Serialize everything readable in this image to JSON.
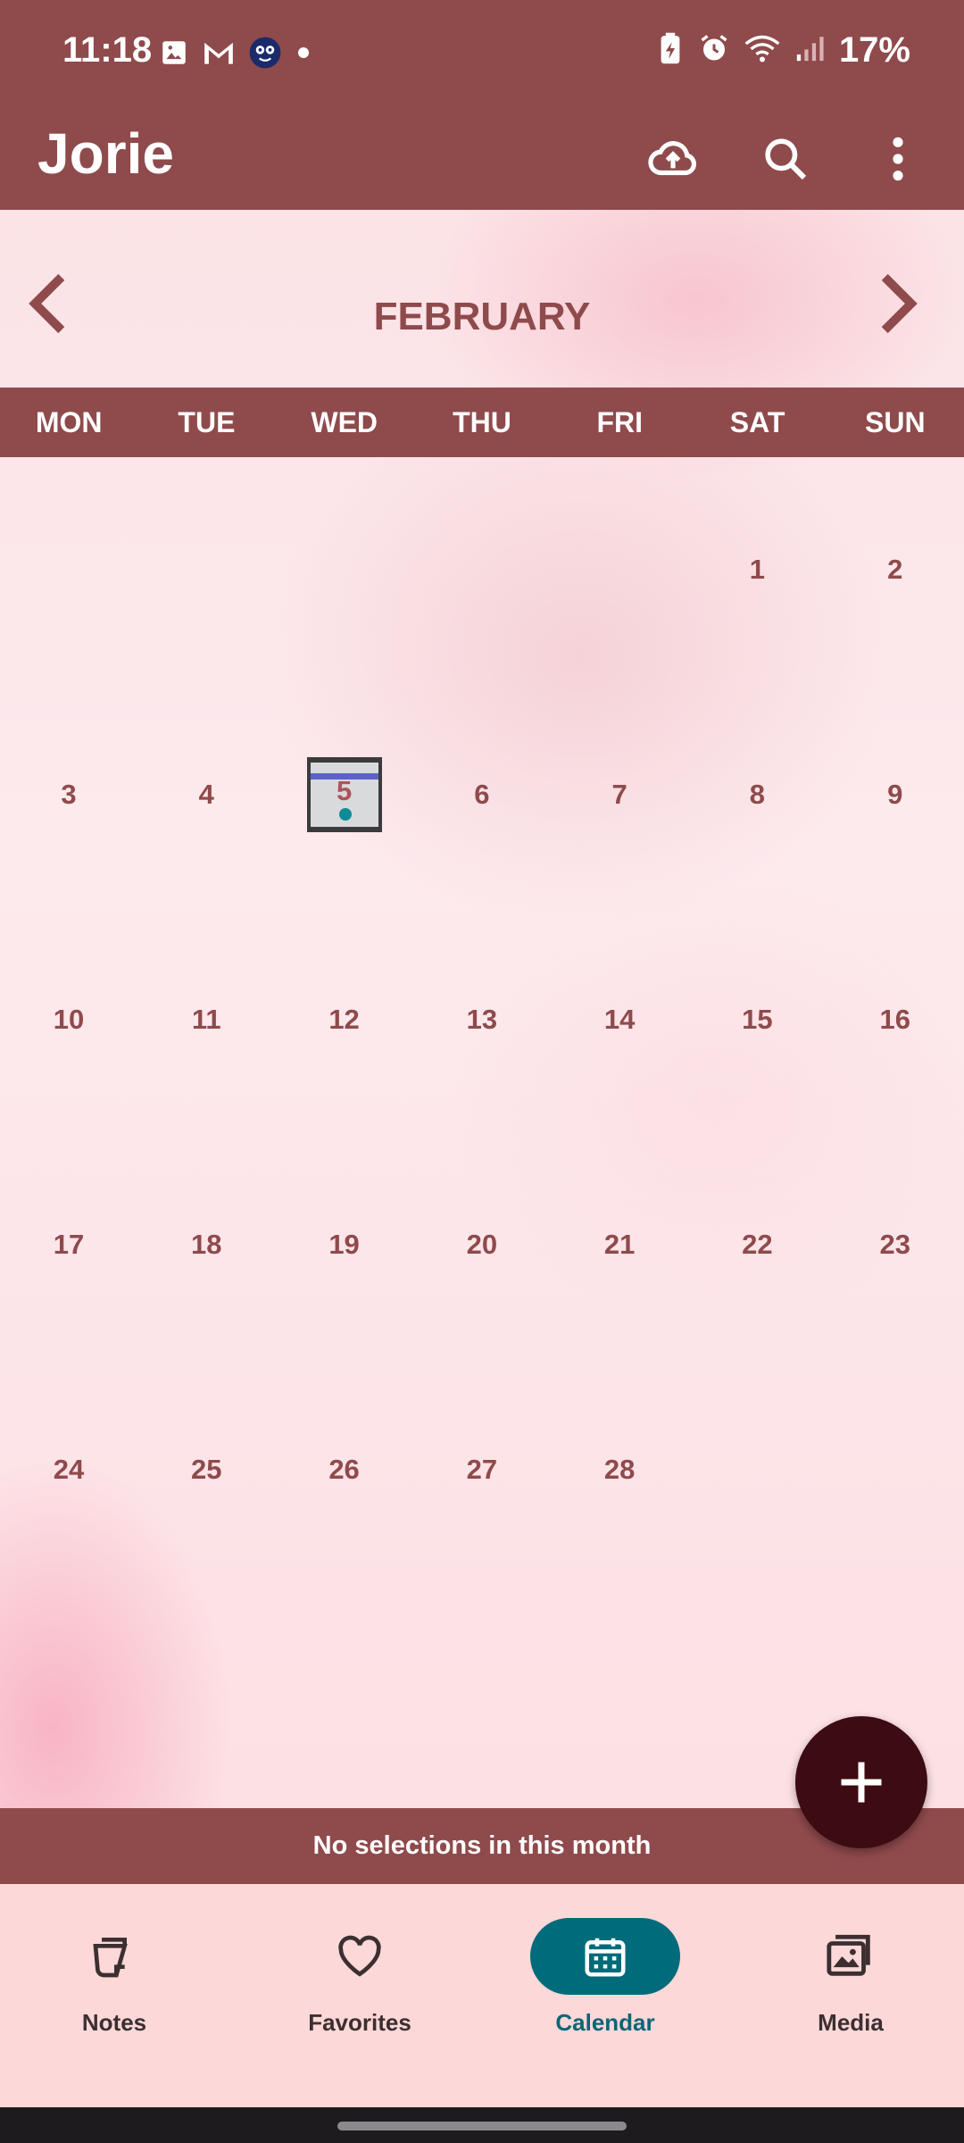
{
  "status_bar": {
    "time": "11:18",
    "battery_percent": "17%",
    "left_icons": [
      "image-icon",
      "gmail-icon",
      "app-face-icon",
      "dot-icon"
    ],
    "right_icons": [
      "battery-saver-icon",
      "alarm-icon",
      "wifi-icon",
      "signal-icon"
    ]
  },
  "app_bar": {
    "title": "Jorie",
    "actions": [
      "cloud-upload-icon",
      "search-icon",
      "more-vert-icon"
    ]
  },
  "calendar": {
    "month": "FEBRUARY",
    "weekdays": [
      "MON",
      "TUE",
      "WED",
      "THU",
      "FRI",
      "SAT",
      "SUN"
    ],
    "days": [
      "1",
      "2",
      "3",
      "4",
      "5",
      "6",
      "7",
      "8",
      "9",
      "10",
      "11",
      "12",
      "13",
      "14",
      "15",
      "16",
      "17",
      "18",
      "19",
      "20",
      "21",
      "22",
      "23",
      "24",
      "25",
      "26",
      "27",
      "28"
    ],
    "days_with_entries": [
      "5"
    ]
  },
  "selection_message": "No selections in this month",
  "bottom_nav": {
    "items": [
      {
        "label": "Notes",
        "icon": "notes-icon"
      },
      {
        "label": "Favorites",
        "icon": "heart-icon"
      },
      {
        "label": "Calendar",
        "icon": "calendar-icon"
      },
      {
        "label": "Media",
        "icon": "media-icon"
      }
    ],
    "active": "Calendar"
  },
  "colors": {
    "primary": "#8f4a4c",
    "fab": "#3d0b12",
    "active_nav": "#006b7a",
    "nav_background": "#fdd8d8"
  }
}
